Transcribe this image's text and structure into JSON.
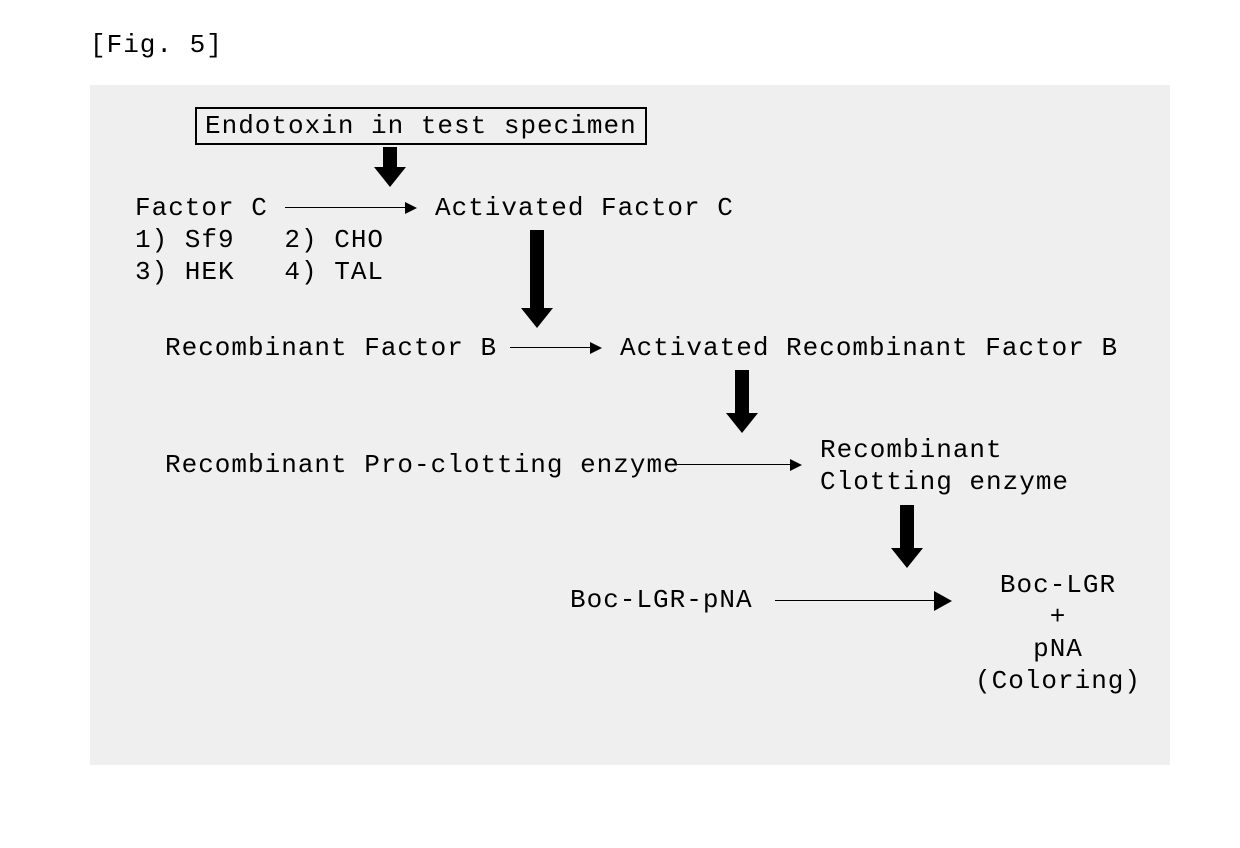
{
  "caption": "[Fig. 5]",
  "box_endotoxin": "Endotoxin in test specimen",
  "factor_c": "Factor C",
  "factor_c_sources_line1": "1) Sf9   2) CHO",
  "factor_c_sources_line2": "3) HEK   4) TAL",
  "activated_factor_c": "Activated Factor C",
  "recomb_factor_b": "Recombinant Factor B",
  "activated_recomb_factor_b": "Activated Recombinant Factor B",
  "recomb_pro_clotting": "Recombinant Pro-clotting enzyme",
  "recomb_clotting_l1": "Recombinant",
  "recomb_clotting_l2": "Clotting enzyme",
  "substrate": "Boc-LGR-pNA",
  "product_l1": "Boc-LGR",
  "product_l2": "+",
  "product_l3": "pNA",
  "product_l4": "(Coloring)",
  "chart_data": {
    "type": "flowchart",
    "nodes": [
      {
        "id": "endotoxin",
        "label": "Endotoxin in test specimen",
        "role": "trigger",
        "boxed": true
      },
      {
        "id": "factor_c",
        "label": "Factor C",
        "sources": [
          "Sf9",
          "CHO",
          "HEK",
          "TAL"
        ]
      },
      {
        "id": "activated_factor_c",
        "label": "Activated Factor C"
      },
      {
        "id": "recomb_factor_b",
        "label": "Recombinant Factor B"
      },
      {
        "id": "activated_recomb_factor_b",
        "label": "Activated Recombinant Factor B"
      },
      {
        "id": "pro_clotting_enzyme",
        "label": "Recombinant Pro-clotting enzyme"
      },
      {
        "id": "clotting_enzyme",
        "label": "Recombinant Clotting enzyme"
      },
      {
        "id": "substrate",
        "label": "Boc-LGR-pNA"
      },
      {
        "id": "products",
        "label": "Boc-LGR + pNA (Coloring)"
      }
    ],
    "edges": [
      {
        "from": "endotoxin",
        "to": "factor_c",
        "role": "activates",
        "style": "thick"
      },
      {
        "from": "factor_c",
        "to": "activated_factor_c",
        "role": "converts",
        "style": "thin"
      },
      {
        "from": "activated_factor_c",
        "to": "recomb_factor_b",
        "role": "activates",
        "style": "thick"
      },
      {
        "from": "recomb_factor_b",
        "to": "activated_recomb_factor_b",
        "role": "converts",
        "style": "thin"
      },
      {
        "from": "activated_recomb_factor_b",
        "to": "pro_clotting_enzyme",
        "role": "activates",
        "style": "thick"
      },
      {
        "from": "pro_clotting_enzyme",
        "to": "clotting_enzyme",
        "role": "converts",
        "style": "thin"
      },
      {
        "from": "clotting_enzyme",
        "to": "substrate",
        "role": "cleaves",
        "style": "thick"
      },
      {
        "from": "substrate",
        "to": "products",
        "role": "yields",
        "style": "thin"
      }
    ]
  }
}
